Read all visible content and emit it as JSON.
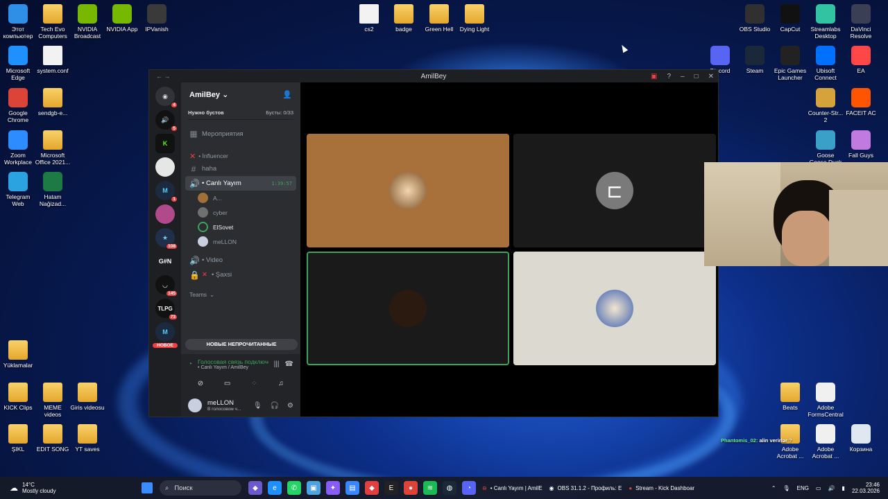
{
  "desktop": {
    "icons_left": [
      {
        "label": "Этот компьютер",
        "icon": "computer-icon"
      },
      {
        "label": "Tech Evo Computers",
        "icon": "folder-icon"
      },
      {
        "label": "NVIDIA Broadcast",
        "icon": "nvidia-broadcast-icon"
      },
      {
        "label": "NVIDIA App",
        "icon": "nvidia-icon"
      },
      {
        "label": "IPVanish",
        "icon": "ipvanish-icon"
      },
      {
        "label": "Microsoft Edge",
        "icon": "edge-icon"
      },
      {
        "label": "system.conf",
        "icon": "file-icon"
      },
      {
        "label": "Google Chrome",
        "icon": "chrome-icon"
      },
      {
        "label": "sendgb-e...",
        "icon": "zip-folder-icon"
      },
      {
        "label": "Zoom Workplace",
        "icon": "zoom-icon"
      },
      {
        "label": "Microsoft Office 2021...",
        "icon": "folder-icon"
      },
      {
        "label": "Telegram Web",
        "icon": "telegram-icon"
      },
      {
        "label": "Hatam Nağizad...",
        "icon": "excel-icon"
      },
      {
        "label": "Yüklamalar",
        "icon": "folder-icon"
      },
      {
        "label": "KICK Clips",
        "icon": "folder-icon"
      },
      {
        "label": "MEME videos",
        "icon": "folder-icon"
      },
      {
        "label": "Giris videosu",
        "icon": "folder-icon"
      },
      {
        "label": "ŞIKL",
        "icon": "folder-icon"
      },
      {
        "label": "EDIT SONG",
        "icon": "folder-icon"
      },
      {
        "label": "YT saves",
        "icon": "folder-icon"
      }
    ],
    "icons_top": [
      {
        "label": "cs2",
        "icon": "file-icon"
      },
      {
        "label": "badge",
        "icon": "folder-icon"
      },
      {
        "label": "Green Hell",
        "icon": "folder-icon"
      },
      {
        "label": "Dying Light",
        "icon": "folder-icon"
      }
    ],
    "icons_right": [
      {
        "label": "OBS Studio",
        "icon": "obs-icon"
      },
      {
        "label": "CapCut",
        "icon": "capcut-icon"
      },
      {
        "label": "Streamlabs Desktop",
        "icon": "streamlabs-icon"
      },
      {
        "label": "DaVinci Resolve",
        "icon": "davinci-icon"
      },
      {
        "label": "Discord",
        "icon": "discord-icon"
      },
      {
        "label": "Steam",
        "icon": "steam-icon"
      },
      {
        "label": "Epic Games Launcher",
        "icon": "epic-icon"
      },
      {
        "label": "Ubisoft Connect",
        "icon": "ubisoft-icon"
      },
      {
        "label": "EA",
        "icon": "ea-icon"
      },
      {
        "label": "Counter-Str... 2",
        "icon": "cs2-icon"
      },
      {
        "label": "FACEIT AC",
        "icon": "faceit-icon"
      },
      {
        "label": "Goose Goose Duck",
        "icon": "goose-icon"
      },
      {
        "label": "Fall Guys",
        "icon": "fallguys-icon"
      },
      {
        "label": "Beats",
        "icon": "folder-icon"
      },
      {
        "label": "Adobe FormsCentral",
        "icon": "adobe-icon"
      },
      {
        "label": "Adobe Acrobat ...",
        "icon": "folder-icon"
      },
      {
        "label": "Adobe Acrobat ...",
        "icon": "acrobat-icon"
      },
      {
        "label": "Корзина",
        "icon": "recycle-bin-icon"
      }
    ],
    "chat_overlay": {
      "user": "Phantomis_02:",
      "text": "alin verirlər ?"
    }
  },
  "discord": {
    "window_title": "AmilBey",
    "guild_name": "AmilBey",
    "boost_label": "Нужно бустов",
    "boost_count": "Бусты: 0/33",
    "events": "Мероприятия",
    "category_influencer": "• İnfluencer",
    "channel_haha": "haha",
    "channel_live": "• Canlı Yayım",
    "live_timer": "1:39:57",
    "members": [
      "A...",
      "cyber",
      "ElSovet",
      "meLLON"
    ],
    "channel_video": "• Video",
    "channel_private": "• Şaxsi",
    "category_teams": "Teams",
    "new_unread": "НОВЫЕ НЕПРОЧИТАННЫЕ",
    "new_label": "НОВОЕ",
    "voice_status": "Голосовая связь подключена",
    "voice_channel": "• Canlı Yayım / AmilBey",
    "user_name": "meLLON",
    "user_status": "В голосовом ч...",
    "server_badges": [
      "4",
      "5",
      "1",
      "108",
      "145",
      "73"
    ],
    "server_label_gn": "G#N",
    "server_label_tlpg": "TLPG",
    "accent": "#5865f2",
    "green": "#3ba55c"
  },
  "taskbar": {
    "weather_temp": "14°C",
    "weather_desc": "Mostly cloudy",
    "search_placeholder": "Поиск",
    "tasks": [
      {
        "label": "• Canlı Yayım | AmilE",
        "icon": "discord-icon"
      },
      {
        "label": "OBS 31.1.2 - Профиль: E",
        "icon": "obs-icon"
      },
      {
        "label": "Stream - Kick Dashboar",
        "icon": "chrome-icon"
      }
    ],
    "lang": "ENG",
    "time": "23:46",
    "date": "22.03.2026"
  }
}
